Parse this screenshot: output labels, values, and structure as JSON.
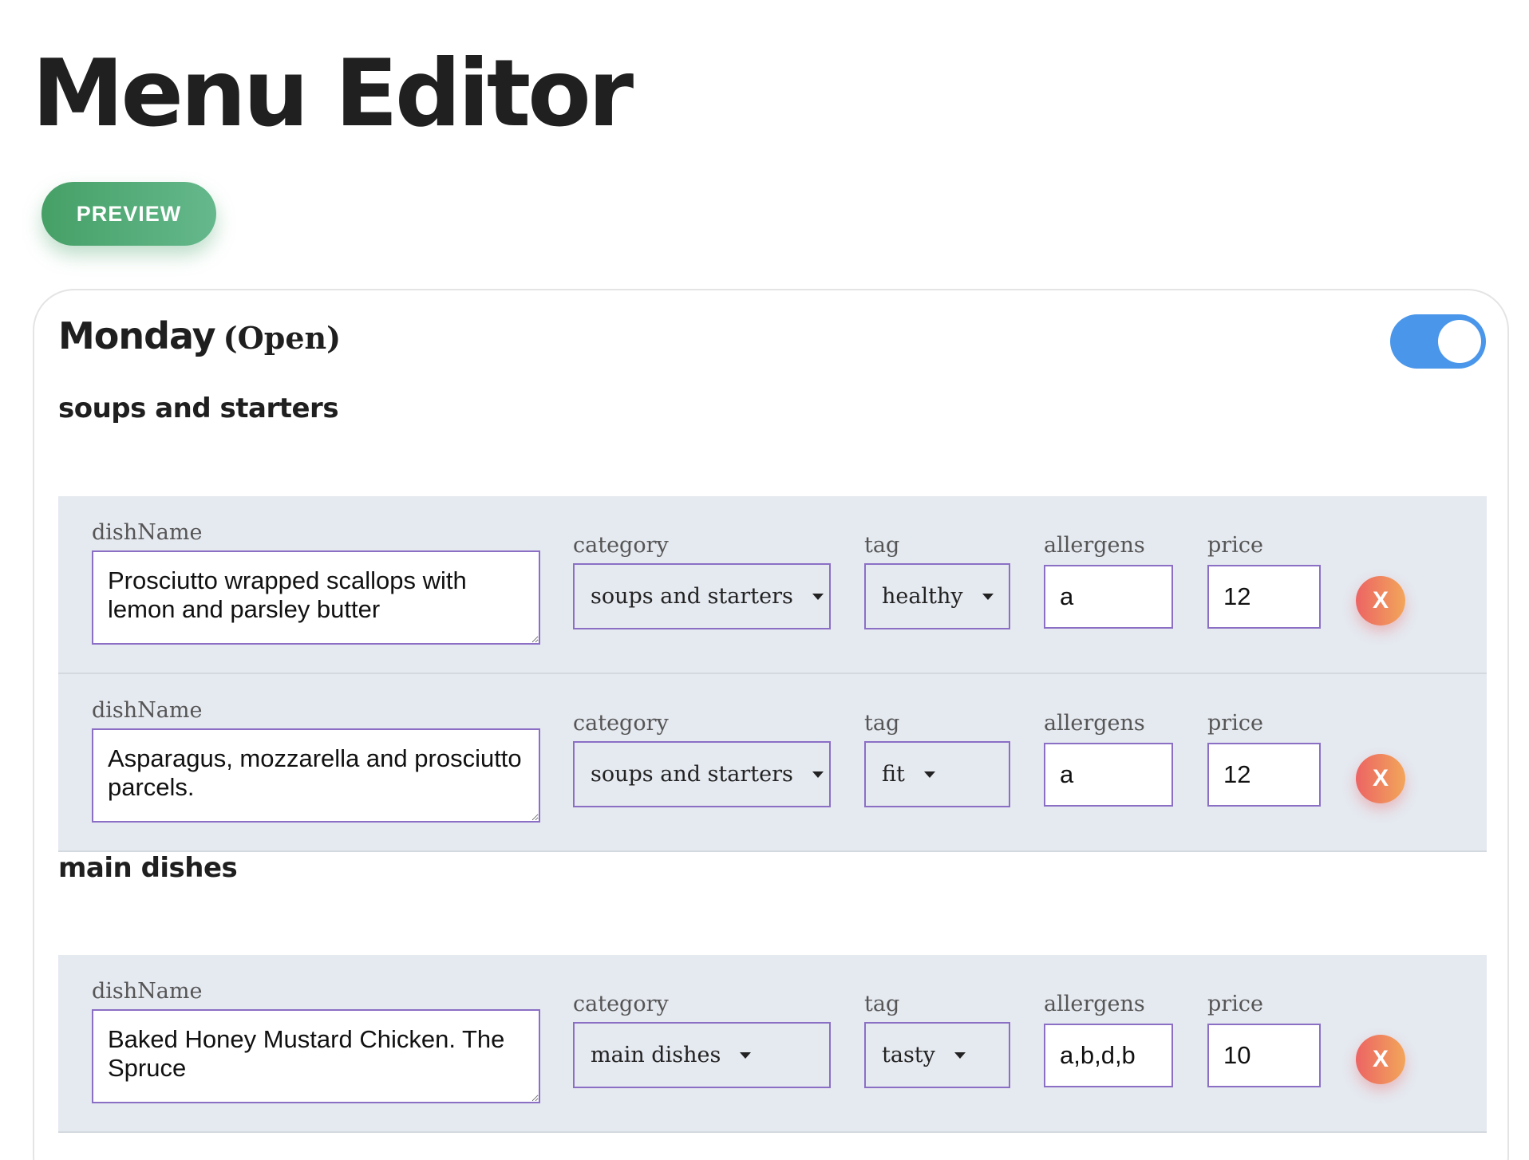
{
  "page": {
    "title": "Menu Editor",
    "preview_label": "PREVIEW"
  },
  "day": {
    "name": "Monday",
    "status": "(Open)",
    "open_toggle_on": true,
    "toggle_color": "#4a96ea"
  },
  "labels": {
    "dishName": "dishName",
    "category": "category",
    "tag": "tag",
    "allergens": "allergens",
    "price": "price",
    "delete": "X"
  },
  "sections": [
    {
      "title": "soups and starters",
      "dishes": [
        {
          "dishName": "Prosciutto wrapped scallops with lemon and parsley butter",
          "category": "soups and starters",
          "tag": "healthy",
          "allergens": "a",
          "price": "12"
        },
        {
          "dishName": "Asparagus, mozzarella and prosciutto parcels.",
          "category": "soups and starters",
          "tag": "fit",
          "allergens": "a",
          "price": "12"
        }
      ]
    },
    {
      "title": "main dishes",
      "dishes": [
        {
          "dishName": "Baked Honey Mustard Chicken. The Spruce",
          "category": "main dishes",
          "tag": "tasty",
          "allergens": "a,b,d,b",
          "price": "10"
        }
      ]
    }
  ],
  "colors": {
    "preview_gradient": [
      "#45a066",
      "#65b88c"
    ],
    "delete_gradient": [
      "#ec6464",
      "#f2a65a"
    ],
    "row_background": "#e5e9f0",
    "field_border": "#8b6fc5"
  }
}
